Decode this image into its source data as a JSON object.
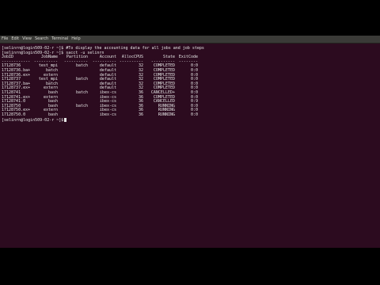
{
  "menu": [
    "File",
    "Edit",
    "View",
    "Search",
    "Terminal",
    "Help"
  ],
  "prompt": "[selinrn@login509-02-r ~]$",
  "session": [
    {
      "type": "cmd",
      "text": "#To display the accounting data for all jobs and job steps"
    },
    {
      "type": "cmd",
      "text": "sacct -u selinrn"
    }
  ],
  "table": {
    "headers": [
      "JobID",
      "JobName",
      "Partition",
      "Account",
      "AllocCPUS",
      "State",
      "ExitCode"
    ],
    "separator": [
      "------------",
      "----------",
      "----------",
      "----------",
      "----------",
      "----------",
      "--------"
    ],
    "rows": [
      [
        "17128736",
        "test_mpi",
        "batch",
        "default",
        "32",
        "COMPLETED",
        "0:0"
      ],
      [
        "17128736.ba+",
        "batch",
        "",
        "default",
        "32",
        "COMPLETED",
        "0:0"
      ],
      [
        "17128736.ex+",
        "extern",
        "",
        "default",
        "32",
        "COMPLETED",
        "0:0"
      ],
      [
        "17128737",
        "test_mpi",
        "batch",
        "default",
        "32",
        "COMPLETED",
        "0:0"
      ],
      [
        "17128737.ba+",
        "batch",
        "",
        "default",
        "32",
        "COMPLETED",
        "0:0"
      ],
      [
        "17128737.ex+",
        "extern",
        "",
        "default",
        "32",
        "COMPLETED",
        "0:0"
      ],
      [
        "17128741",
        "bash",
        "batch",
        "ibex-cs",
        "36",
        "CANCELLED+",
        "0:0"
      ],
      [
        "17128741.ex+",
        "extern",
        "",
        "ibex-cs",
        "36",
        "COMPLETED",
        "0:0"
      ],
      [
        "17128741.0",
        "bash",
        "",
        "ibex-cs",
        "36",
        "CANCELLED",
        "0:9"
      ],
      [
        "17128750",
        "bash",
        "batch",
        "ibex-cs",
        "36",
        "RUNNING",
        "0:0"
      ],
      [
        "17128750.ex+",
        "extern",
        "",
        "ibex-cs",
        "36",
        "RUNNING",
        "0:0"
      ],
      [
        "17128750.0",
        "bash",
        "",
        "ibex-cs",
        "36",
        "RUNNING",
        "0:0"
      ]
    ]
  },
  "colors": {
    "terminal_bg": "#2c0b1f",
    "menubar_bg": "#3a3a37",
    "text": "#e6e6e6"
  }
}
